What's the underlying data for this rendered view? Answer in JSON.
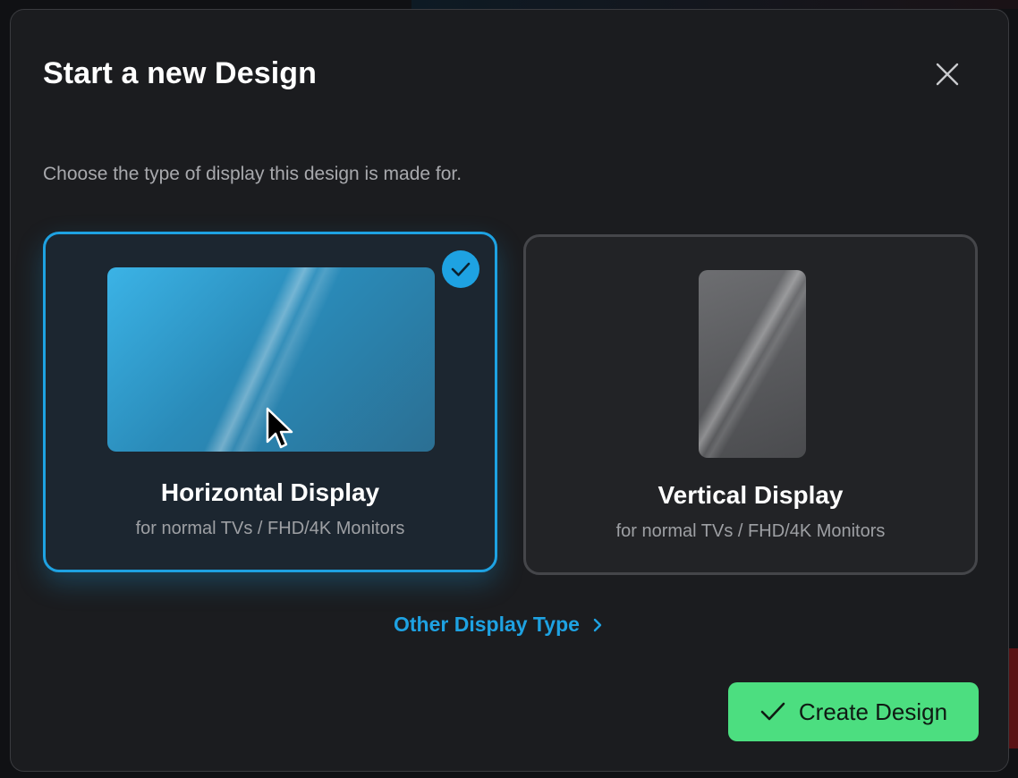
{
  "dialog": {
    "title": "Start a new Design",
    "subtitle": "Choose the type of display this design is made for.",
    "close_icon": "close-icon"
  },
  "options": [
    {
      "title": "Horizontal Display",
      "subtitle": "for normal TVs / FHD/4K Monitors",
      "selected": true,
      "icon": "landscape-screen-icon"
    },
    {
      "title": "Vertical Display",
      "subtitle": "for normal TVs / FHD/4K Monitors",
      "selected": false,
      "icon": "portrait-screen-icon"
    }
  ],
  "other_link": {
    "label": "Other Display Type",
    "icon": "chevron-right-icon"
  },
  "create_button": {
    "label": "Create Design",
    "icon": "check-icon"
  },
  "colors": {
    "accent": "#1ea2e2",
    "primary_button": "#4cde80",
    "modal_bg": "#1b1c1f"
  }
}
